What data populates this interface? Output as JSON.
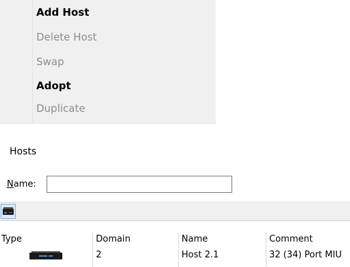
{
  "context_menu": {
    "items": [
      {
        "label": "Add Host",
        "enabled": true
      },
      {
        "label": "Delete Host",
        "enabled": false
      },
      {
        "label": "Swap",
        "enabled": false
      },
      {
        "label": "Adopt",
        "enabled": true
      },
      {
        "label": "Duplicate",
        "enabled": false
      }
    ]
  },
  "hosts_panel": {
    "title": "Hosts",
    "filter": {
      "label_mnemonic": "N",
      "label_rest": "ame:",
      "value": ""
    },
    "toolbar": {
      "buttons": [
        {
          "icon": "host-device-icon",
          "active": true
        }
      ]
    },
    "table": {
      "columns": [
        "Type",
        "Domain",
        "Name",
        "Comment"
      ],
      "rows": [
        {
          "type_icon": "host-device-icon",
          "domain": "2",
          "name": "Host 2.1",
          "comment": "32 (34) Port MIU"
        }
      ]
    }
  },
  "colors": {
    "menu_background": "#f0f0f0",
    "disabled_text": "#8c8c8c",
    "toolbar_active": "#dbe9f7",
    "device_body": "#1a1a1a",
    "device_led": "#3a8fd8"
  }
}
